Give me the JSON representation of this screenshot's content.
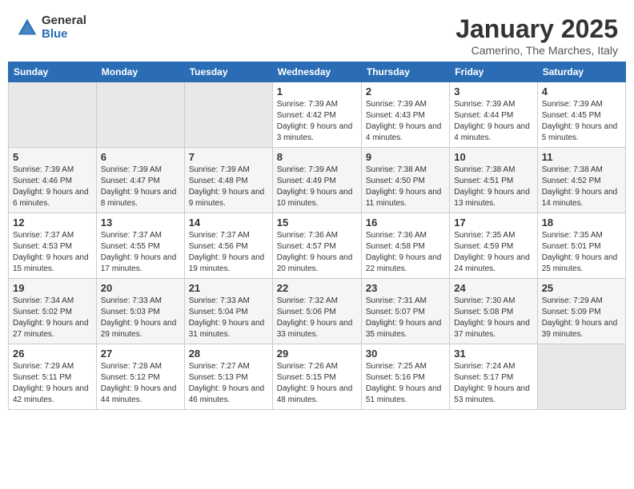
{
  "header": {
    "logo_general": "General",
    "logo_blue": "Blue",
    "title": "January 2025",
    "subtitle": "Camerino, The Marches, Italy"
  },
  "weekdays": [
    "Sunday",
    "Monday",
    "Tuesday",
    "Wednesday",
    "Thursday",
    "Friday",
    "Saturday"
  ],
  "weeks": [
    [
      {
        "day": "",
        "info": ""
      },
      {
        "day": "",
        "info": ""
      },
      {
        "day": "",
        "info": ""
      },
      {
        "day": "1",
        "info": "Sunrise: 7:39 AM\nSunset: 4:42 PM\nDaylight: 9 hours and 3 minutes."
      },
      {
        "day": "2",
        "info": "Sunrise: 7:39 AM\nSunset: 4:43 PM\nDaylight: 9 hours and 4 minutes."
      },
      {
        "day": "3",
        "info": "Sunrise: 7:39 AM\nSunset: 4:44 PM\nDaylight: 9 hours and 4 minutes."
      },
      {
        "day": "4",
        "info": "Sunrise: 7:39 AM\nSunset: 4:45 PM\nDaylight: 9 hours and 5 minutes."
      }
    ],
    [
      {
        "day": "5",
        "info": "Sunrise: 7:39 AM\nSunset: 4:46 PM\nDaylight: 9 hours and 6 minutes."
      },
      {
        "day": "6",
        "info": "Sunrise: 7:39 AM\nSunset: 4:47 PM\nDaylight: 9 hours and 8 minutes."
      },
      {
        "day": "7",
        "info": "Sunrise: 7:39 AM\nSunset: 4:48 PM\nDaylight: 9 hours and 9 minutes."
      },
      {
        "day": "8",
        "info": "Sunrise: 7:39 AM\nSunset: 4:49 PM\nDaylight: 9 hours and 10 minutes."
      },
      {
        "day": "9",
        "info": "Sunrise: 7:38 AM\nSunset: 4:50 PM\nDaylight: 9 hours and 11 minutes."
      },
      {
        "day": "10",
        "info": "Sunrise: 7:38 AM\nSunset: 4:51 PM\nDaylight: 9 hours and 13 minutes."
      },
      {
        "day": "11",
        "info": "Sunrise: 7:38 AM\nSunset: 4:52 PM\nDaylight: 9 hours and 14 minutes."
      }
    ],
    [
      {
        "day": "12",
        "info": "Sunrise: 7:37 AM\nSunset: 4:53 PM\nDaylight: 9 hours and 15 minutes."
      },
      {
        "day": "13",
        "info": "Sunrise: 7:37 AM\nSunset: 4:55 PM\nDaylight: 9 hours and 17 minutes."
      },
      {
        "day": "14",
        "info": "Sunrise: 7:37 AM\nSunset: 4:56 PM\nDaylight: 9 hours and 19 minutes."
      },
      {
        "day": "15",
        "info": "Sunrise: 7:36 AM\nSunset: 4:57 PM\nDaylight: 9 hours and 20 minutes."
      },
      {
        "day": "16",
        "info": "Sunrise: 7:36 AM\nSunset: 4:58 PM\nDaylight: 9 hours and 22 minutes."
      },
      {
        "day": "17",
        "info": "Sunrise: 7:35 AM\nSunset: 4:59 PM\nDaylight: 9 hours and 24 minutes."
      },
      {
        "day": "18",
        "info": "Sunrise: 7:35 AM\nSunset: 5:01 PM\nDaylight: 9 hours and 25 minutes."
      }
    ],
    [
      {
        "day": "19",
        "info": "Sunrise: 7:34 AM\nSunset: 5:02 PM\nDaylight: 9 hours and 27 minutes."
      },
      {
        "day": "20",
        "info": "Sunrise: 7:33 AM\nSunset: 5:03 PM\nDaylight: 9 hours and 29 minutes."
      },
      {
        "day": "21",
        "info": "Sunrise: 7:33 AM\nSunset: 5:04 PM\nDaylight: 9 hours and 31 minutes."
      },
      {
        "day": "22",
        "info": "Sunrise: 7:32 AM\nSunset: 5:06 PM\nDaylight: 9 hours and 33 minutes."
      },
      {
        "day": "23",
        "info": "Sunrise: 7:31 AM\nSunset: 5:07 PM\nDaylight: 9 hours and 35 minutes."
      },
      {
        "day": "24",
        "info": "Sunrise: 7:30 AM\nSunset: 5:08 PM\nDaylight: 9 hours and 37 minutes."
      },
      {
        "day": "25",
        "info": "Sunrise: 7:29 AM\nSunset: 5:09 PM\nDaylight: 9 hours and 39 minutes."
      }
    ],
    [
      {
        "day": "26",
        "info": "Sunrise: 7:29 AM\nSunset: 5:11 PM\nDaylight: 9 hours and 42 minutes."
      },
      {
        "day": "27",
        "info": "Sunrise: 7:28 AM\nSunset: 5:12 PM\nDaylight: 9 hours and 44 minutes."
      },
      {
        "day": "28",
        "info": "Sunrise: 7:27 AM\nSunset: 5:13 PM\nDaylight: 9 hours and 46 minutes."
      },
      {
        "day": "29",
        "info": "Sunrise: 7:26 AM\nSunset: 5:15 PM\nDaylight: 9 hours and 48 minutes."
      },
      {
        "day": "30",
        "info": "Sunrise: 7:25 AM\nSunset: 5:16 PM\nDaylight: 9 hours and 51 minutes."
      },
      {
        "day": "31",
        "info": "Sunrise: 7:24 AM\nSunset: 5:17 PM\nDaylight: 9 hours and 53 minutes."
      },
      {
        "day": "",
        "info": ""
      }
    ]
  ]
}
